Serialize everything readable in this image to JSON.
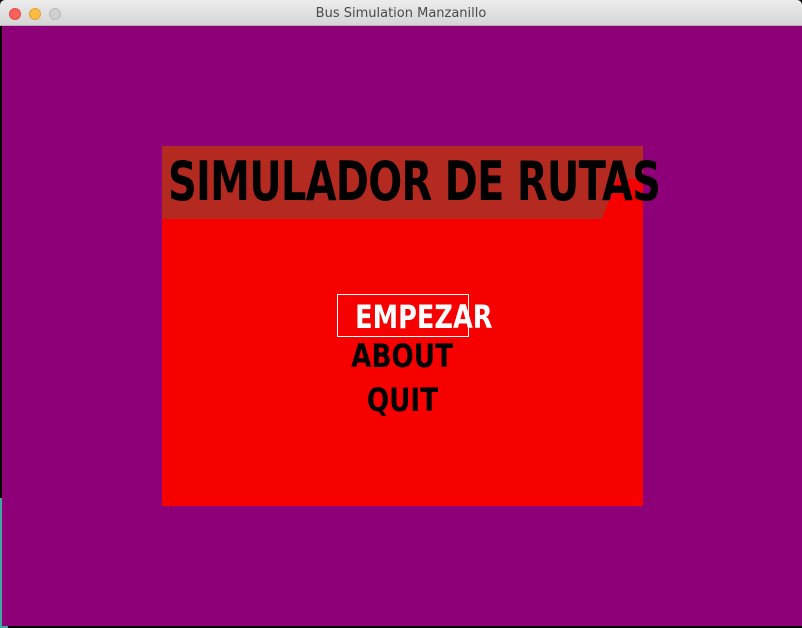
{
  "window": {
    "title": "Bus Simulation Manzanillo"
  },
  "colors": {
    "background": "#8e0078",
    "panel": "#f70000",
    "panel_header": "#b52a20",
    "title_text": "#000000",
    "selected_text": "#ffffff"
  },
  "panel": {
    "title": "SIMULADOR DE RUTAS"
  },
  "menu": {
    "items": [
      {
        "label": "EMPEZAR",
        "selected": true
      },
      {
        "label": "ABOUT",
        "selected": false
      },
      {
        "label": "QUIT",
        "selected": false
      }
    ]
  }
}
